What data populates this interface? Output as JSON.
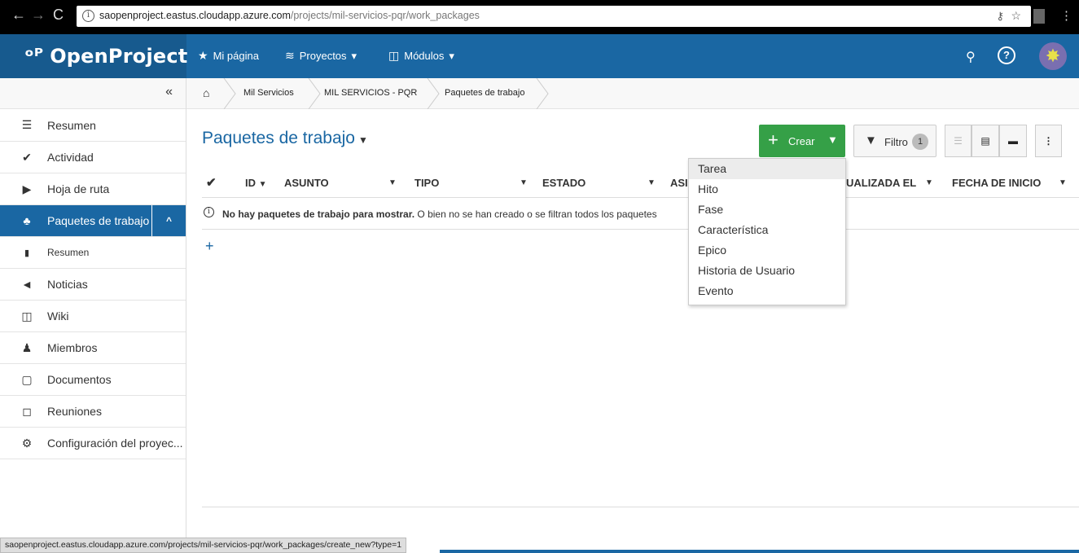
{
  "browser": {
    "url_host": "saopenproject.eastus.cloudapp.azure.com",
    "url_path": "/projects/mil-servicios-pqr/work_packages"
  },
  "header": {
    "logo": "OpenProject",
    "menu": [
      {
        "icon": "★",
        "label": "Mi página"
      },
      {
        "icon": "≋",
        "label": "Proyectos",
        "caret": "▾"
      },
      {
        "icon": "◫",
        "label": "Módulos",
        "caret": "▾"
      }
    ]
  },
  "breadcrumb": {
    "home": "⌂",
    "items": [
      "Mil Servicios",
      "MIL SERVICIOS - PQR",
      "Paquetes de trabajo"
    ]
  },
  "sidebar": {
    "collapse": "«",
    "items": [
      {
        "icon": "☰",
        "label": "Resumen"
      },
      {
        "icon": "✔",
        "label": "Actividad"
      },
      {
        "icon": "▶",
        "label": "Hoja de ruta"
      },
      {
        "icon": "♣",
        "label": "Paquetes de trabajo",
        "expand": "^"
      },
      {
        "icon": "▮",
        "label": "Resumen"
      },
      {
        "icon": "◄",
        "label": "Noticias"
      },
      {
        "icon": "◫",
        "label": "Wiki"
      },
      {
        "icon": "♟",
        "label": "Miembros"
      },
      {
        "icon": "▢",
        "label": "Documentos"
      },
      {
        "icon": "◻",
        "label": "Reuniones"
      },
      {
        "icon": "⚙",
        "label": "Configuración del proyec..."
      }
    ]
  },
  "main": {
    "title": "Paquetes de trabajo",
    "create_label": "Crear",
    "filter_label": "Filtro",
    "filter_count": "1",
    "columns": [
      "ID",
      "ASUNTO",
      "TIPO",
      "ESTADO",
      "ASI",
      "UALIZADA EL",
      "FECHA DE INICIO"
    ],
    "empty_bold": "No hay paquetes de trabajo para mostrar.",
    "empty_rest": " O bien no se han creado o se filtran todos los paquetes",
    "add_row": "+"
  },
  "dropdown": {
    "items": [
      "Tarea",
      "Hito",
      "Fase",
      "Característica",
      "Epico",
      "Historia de Usuario",
      "Evento"
    ]
  },
  "statusbar": {
    "text": "saopenproject.eastus.cloudapp.azure.com/projects/mil-servicios-pqr/work_packages/create_new?type=1"
  },
  "colors": {
    "header": "#1a67a3",
    "logo_bg": "#175a8e",
    "create_button": "#35a047",
    "active_sidebar": "#1a67a3"
  }
}
